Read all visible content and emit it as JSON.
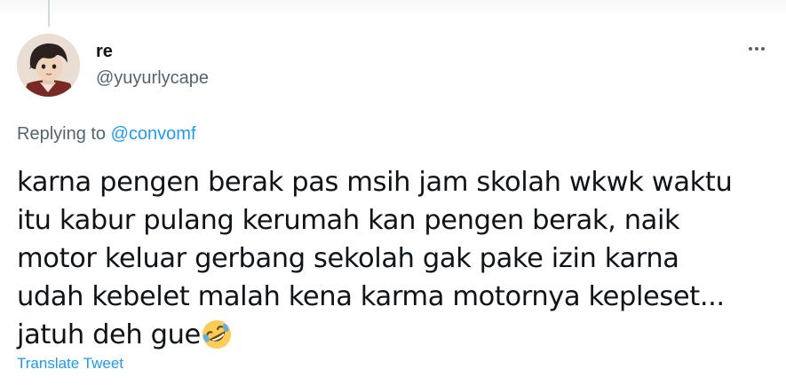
{
  "tweet": {
    "display_name": "re",
    "handle": "@yuyurlycape",
    "replying_prefix": "Replying to ",
    "replying_to": "@convomf",
    "text_lines": [
      "karna pengen berak pas msih jam skolah wkwk waktu",
      "itu kabur pulang kerumah kan pengen berak, naik",
      "motor keluar gerbang sekolah gak pake izin karna",
      "udah kebelet malah kena karma motornya kepleset...",
      "jatuh deh gue"
    ],
    "emoji": "rolling-on-the-floor-laughing-icon",
    "translate_label": "Translate Tweet"
  },
  "colors": {
    "text": "#0f1419",
    "secondary": "#536471",
    "link": "#1d9bf0",
    "thread_line": "#cfd9de"
  }
}
